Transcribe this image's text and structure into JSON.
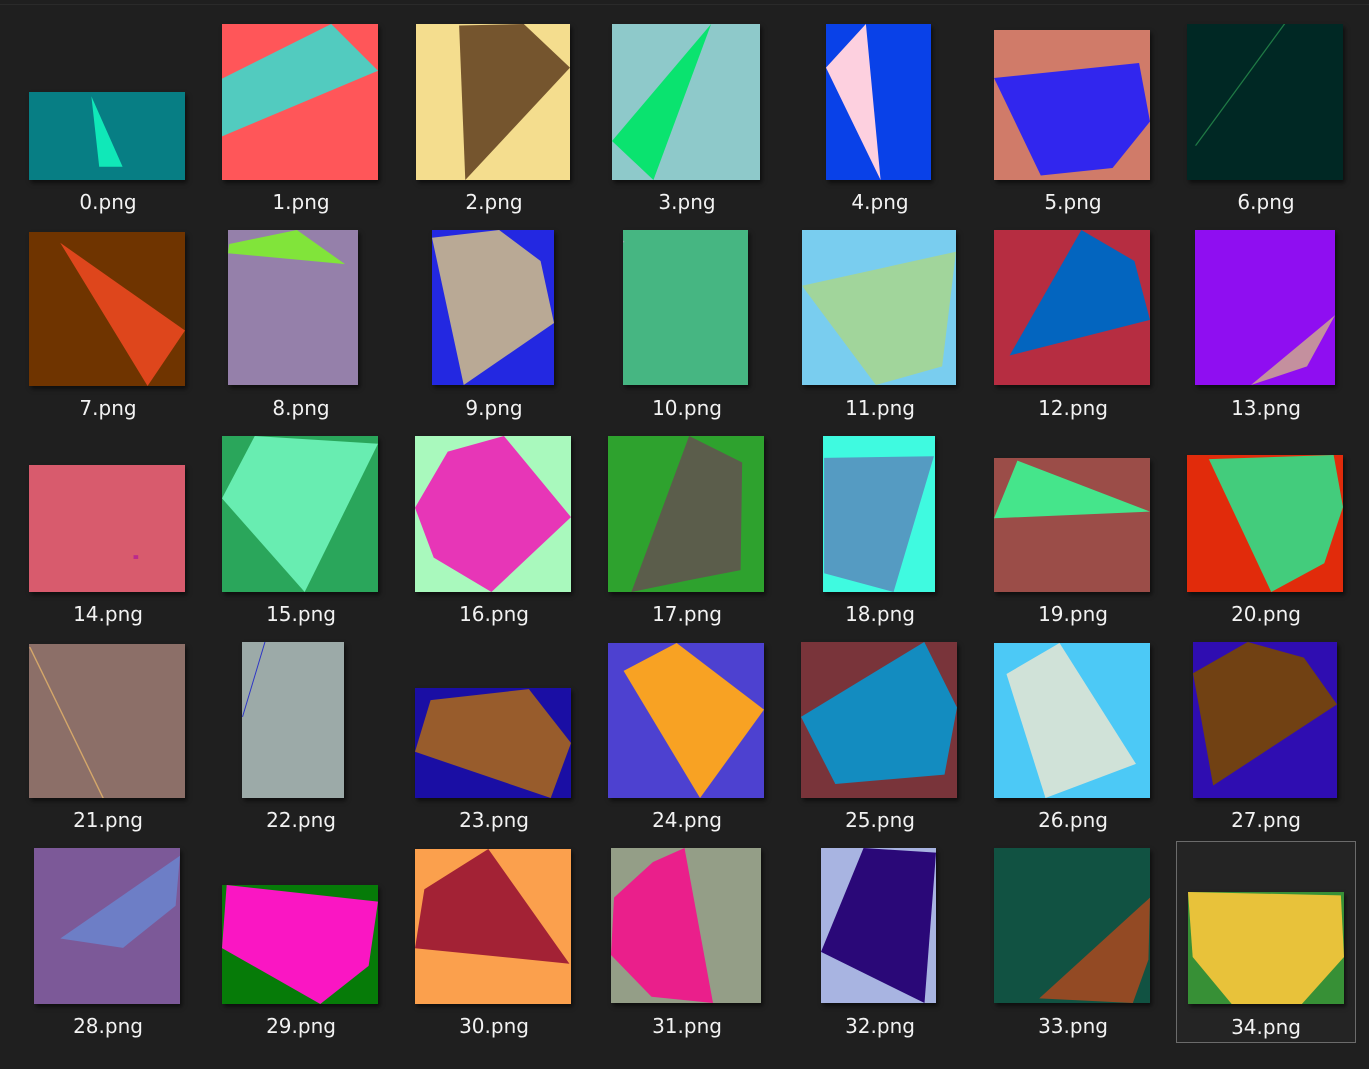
{
  "files": [
    {
      "name": "0.png"
    },
    {
      "name": "1.png"
    },
    {
      "name": "2.png"
    },
    {
      "name": "3.png"
    },
    {
      "name": "4.png"
    },
    {
      "name": "5.png"
    },
    {
      "name": "6.png"
    },
    {
      "name": "7.png"
    },
    {
      "name": "8.png"
    },
    {
      "name": "9.png"
    },
    {
      "name": "10.png"
    },
    {
      "name": "11.png"
    },
    {
      "name": "12.png"
    },
    {
      "name": "13.png"
    },
    {
      "name": "14.png"
    },
    {
      "name": "15.png"
    },
    {
      "name": "16.png"
    },
    {
      "name": "17.png"
    },
    {
      "name": "18.png"
    },
    {
      "name": "19.png"
    },
    {
      "name": "20.png"
    },
    {
      "name": "21.png"
    },
    {
      "name": "22.png"
    },
    {
      "name": "23.png"
    },
    {
      "name": "24.png"
    },
    {
      "name": "25.png"
    },
    {
      "name": "26.png"
    },
    {
      "name": "27.png"
    },
    {
      "name": "28.png"
    },
    {
      "name": "29.png"
    },
    {
      "name": "30.png"
    },
    {
      "name": "31.png"
    },
    {
      "name": "32.png"
    },
    {
      "name": "33.png"
    },
    {
      "name": "34.png"
    }
  ],
  "selected_file": "34.png"
}
